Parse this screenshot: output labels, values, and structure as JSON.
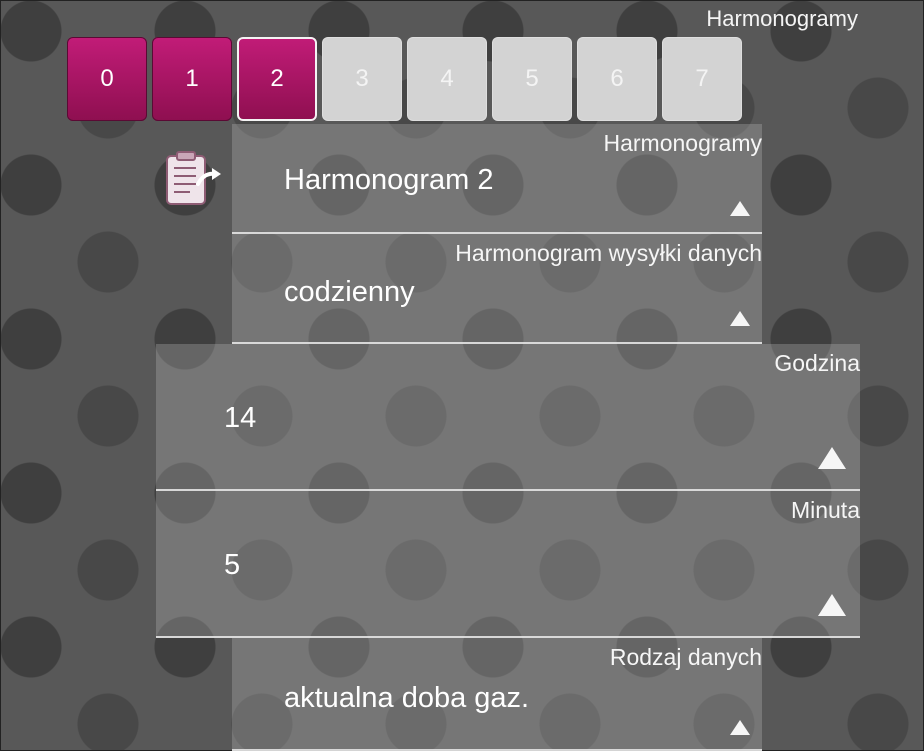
{
  "header": {
    "title": "Harmonogramy"
  },
  "tabs": [
    {
      "label": "0",
      "state": "active"
    },
    {
      "label": "1",
      "state": "active"
    },
    {
      "label": "2",
      "state": "selected"
    },
    {
      "label": "3",
      "state": "inactive"
    },
    {
      "label": "4",
      "state": "inactive"
    },
    {
      "label": "5",
      "state": "inactive"
    },
    {
      "label": "6",
      "state": "inactive"
    },
    {
      "label": "7",
      "state": "inactive"
    }
  ],
  "icons": {
    "export": "document-arrow-icon",
    "dropdown": "triangle-up-icon"
  },
  "fields": {
    "harmonogram": {
      "label": "Harmonogramy",
      "value": "Harmonogram 2"
    },
    "schedule": {
      "label": "Harmonogram wysyłki danych",
      "value": "codzienny"
    },
    "hour": {
      "label": "Godzina",
      "value": "14"
    },
    "minute": {
      "label": "Minuta",
      "value": "5"
    },
    "data_type": {
      "label": "Rodzaj danych",
      "value": "aktualna doba gaz."
    }
  },
  "colors": {
    "accent": "#b0175f",
    "inactive_tab": "#d3d3d3",
    "background": "#585858"
  }
}
